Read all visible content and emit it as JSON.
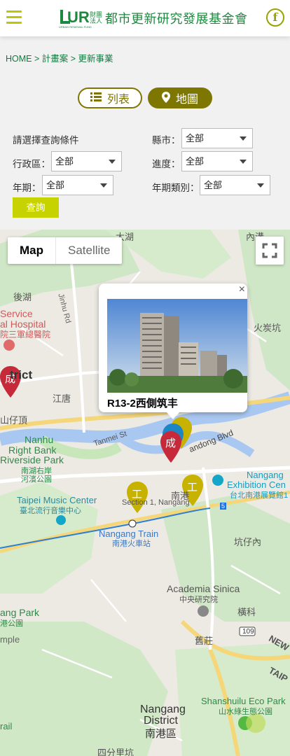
{
  "header": {
    "logo_mark": "UR",
    "logo_small_a": "財團",
    "logo_small_b": "法人",
    "logo_sub": "URBAN RENEWAL FUND",
    "logo_text": "都市更新研究發展基金會",
    "facebook_glyph": "f"
  },
  "breadcrumb": "HOME > 計畫案 > 更新事業",
  "view_toggle": {
    "list_label": "列表",
    "map_label": "地圖"
  },
  "filters": {
    "condition_label": "請選擇查詢條件",
    "county_label": "縣市：",
    "county_value": "全部",
    "district_label": "行政區：",
    "district_value": "全部",
    "progress_label": "進度：",
    "progress_value": "全部",
    "period_label": "年期：",
    "period_value": "全部",
    "period_type_label": "年期類別：",
    "period_type_value": "全部",
    "search_button": "查詢"
  },
  "map": {
    "maptype_map": "Map",
    "maptype_satellite": "Satellite",
    "popup_title": "R13-2西側筑丰",
    "popup_close": "×",
    "marker_done": "成",
    "marker_work": "工",
    "marker_plain": "",
    "labels": {
      "dahu": "大湖",
      "neihu_south": "內溝",
      "houshan": "後湖",
      "jinhu_rd": "Jinhu Rd",
      "service": "Service",
      "hospital": "al Hospital",
      "hospital_zh": "院三軍總醫院",
      "huoyan": "火炭坑",
      "district": "trict",
      "jiangtou": "江唐",
      "shanzaiding": "山仔頂",
      "nanhu": "Nanhu",
      "right_bank": "Right Bank",
      "riverside": "Riverside Park",
      "riverside_zh1": "南湖右岸",
      "riverside_zh2": "河濱公園",
      "tanmei": "Tanmei St",
      "nandong": "andong Blvd",
      "nangang_ex": "Nangang",
      "exhibition": "Exhibition Cen",
      "exhibition_zh": "台北南港展覽館1",
      "section1": "Section 1, Nangang",
      "nan": "南港",
      "music": "Taipei Music Center",
      "music_zh": "臺北流行音樂中心",
      "train": "Nangang Train",
      "train_zh": "南港火車站",
      "kengzi": "坑仔內",
      "academia": "Academia Sinica",
      "academia_zh": "中央研究院",
      "hengke": "橫科",
      "park": "ang Park",
      "park_zh": "港公園",
      "temple": "mple",
      "jiuzhuang": "舊莊",
      "road109": "109",
      "new": "NEW",
      "taipei": "TAIP",
      "shanshui": "Shanshuilu Eco Park",
      "shanshui_zh": "山水綠生態公園",
      "trail": "rail",
      "nangang_dist": "Nangang",
      "district2": "District",
      "nangang_zh": "南港區",
      "sifenli": "四分里坑",
      "road5": "5"
    }
  }
}
